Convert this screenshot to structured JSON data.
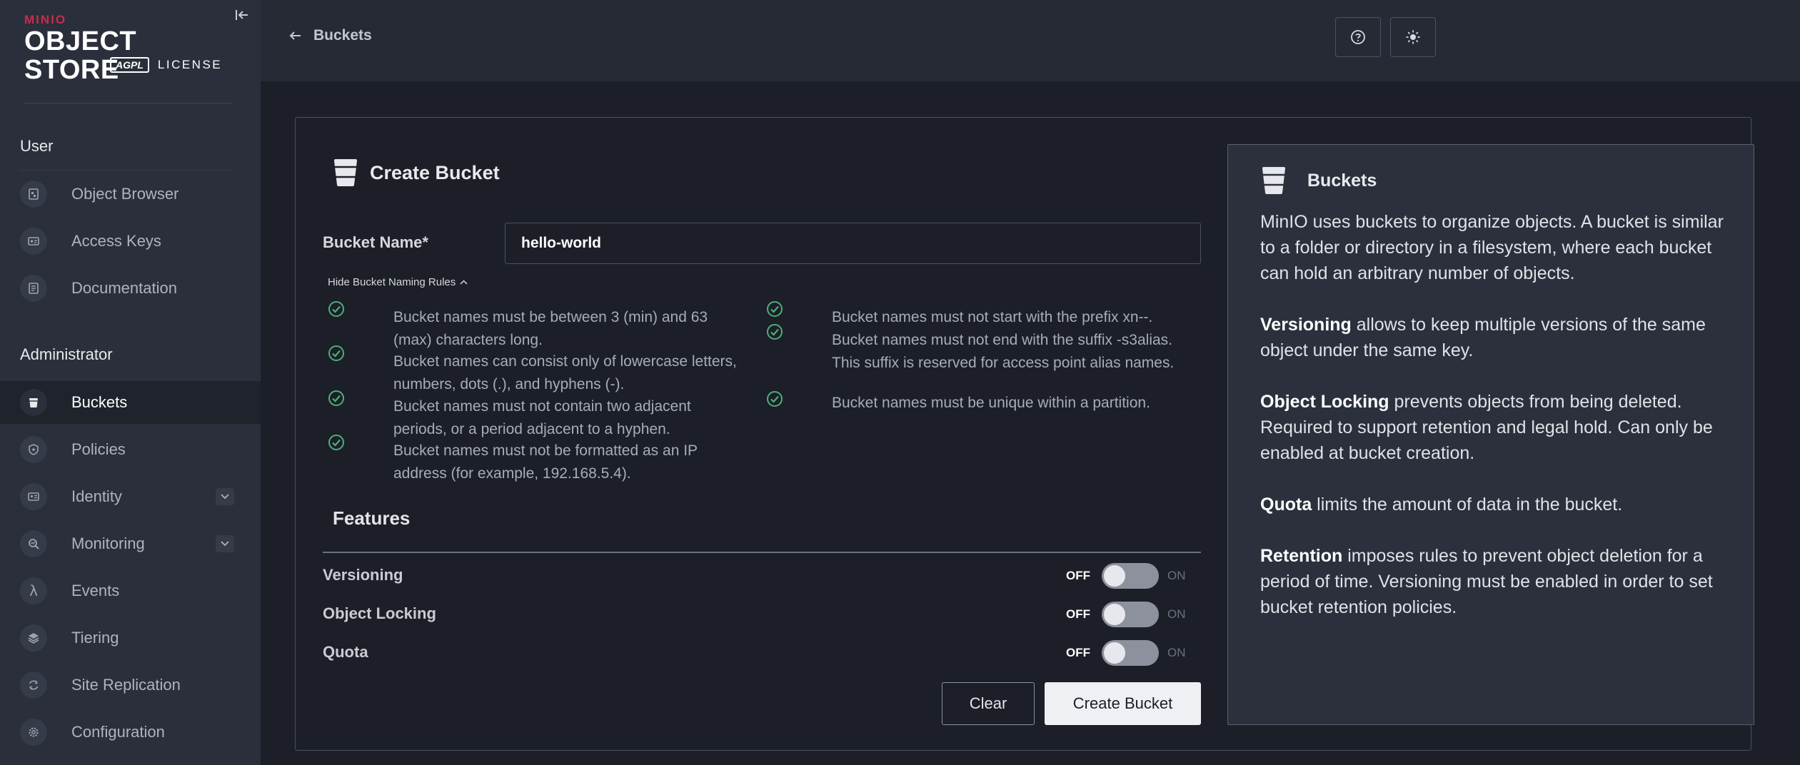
{
  "brand": {
    "minio": "MINIO",
    "product": "OBJECT STORE",
    "agpl": "AGPL",
    "license": "LICENSE"
  },
  "sidebar": {
    "user_section": "User",
    "admin_section": "Administrator",
    "user_items": [
      {
        "label": "Object Browser",
        "icon": "object-browser-icon"
      },
      {
        "label": "Access Keys",
        "icon": "access-keys-icon"
      },
      {
        "label": "Documentation",
        "icon": "documentation-icon"
      }
    ],
    "admin_items": [
      {
        "label": "Buckets",
        "icon": "bucket-icon",
        "active": true
      },
      {
        "label": "Policies",
        "icon": "shield-icon"
      },
      {
        "label": "Identity",
        "icon": "identity-icon",
        "expandable": true
      },
      {
        "label": "Monitoring",
        "icon": "monitoring-icon",
        "expandable": true
      },
      {
        "label": "Events",
        "icon": "lambda-icon"
      },
      {
        "label": "Tiering",
        "icon": "layers-icon"
      },
      {
        "label": "Site Replication",
        "icon": "replication-icon"
      },
      {
        "label": "Configuration",
        "icon": "gear-icon"
      }
    ]
  },
  "header": {
    "back_label": "Buckets"
  },
  "form": {
    "title": "Create Bucket",
    "bucket_name_label": "Bucket Name*",
    "bucket_name_value": "hello-world",
    "rules_toggle": "Hide Bucket Naming Rules",
    "rules_left": [
      "Bucket names must be between 3 (min) and 63 (max) characters long.",
      "Bucket names can consist only of lowercase letters, numbers, dots (.), and hyphens (-).",
      "Bucket names must not contain two adjacent periods, or a period adjacent to a hyphen.",
      "Bucket names must not be formatted as an IP address (for example, 192.168.5.4)."
    ],
    "rules_right": [
      "Bucket names must not start with the prefix xn--.",
      "Bucket names must not end with the suffix -s3alias. This suffix is reserved for access point alias names.",
      "Bucket names must be unique within a partition."
    ],
    "features_title": "Features",
    "features": [
      {
        "label": "Versioning",
        "off": "OFF",
        "on": "ON",
        "enabled": false
      },
      {
        "label": "Object Locking",
        "off": "OFF",
        "on": "ON",
        "enabled": false
      },
      {
        "label": "Quota",
        "off": "OFF",
        "on": "ON",
        "enabled": false
      }
    ],
    "clear_label": "Clear",
    "create_label": "Create Bucket"
  },
  "help": {
    "title": "Buckets",
    "intro": "MinIO uses buckets to organize objects. A bucket is similar to a folder or directory in a filesystem, where each bucket can hold an arbitrary number of objects.",
    "versioning_term": "Versioning",
    "versioning_text": " allows to keep multiple versions of the same object under the same key.",
    "locking_term": "Object Locking",
    "locking_text": " prevents objects from being deleted. Required to support retention and legal hold. Can only be enabled at bucket creation.",
    "quota_term": "Quota",
    "quota_text": " limits the amount of data in the bucket.",
    "retention_term": "Retention",
    "retention_text": " imposes rules to prevent object deletion for a period of time. Versioning must be enabled in order to set bucket retention policies."
  },
  "colors": {
    "accent_check": "#4caf7a",
    "brand_red": "#c72e49"
  }
}
